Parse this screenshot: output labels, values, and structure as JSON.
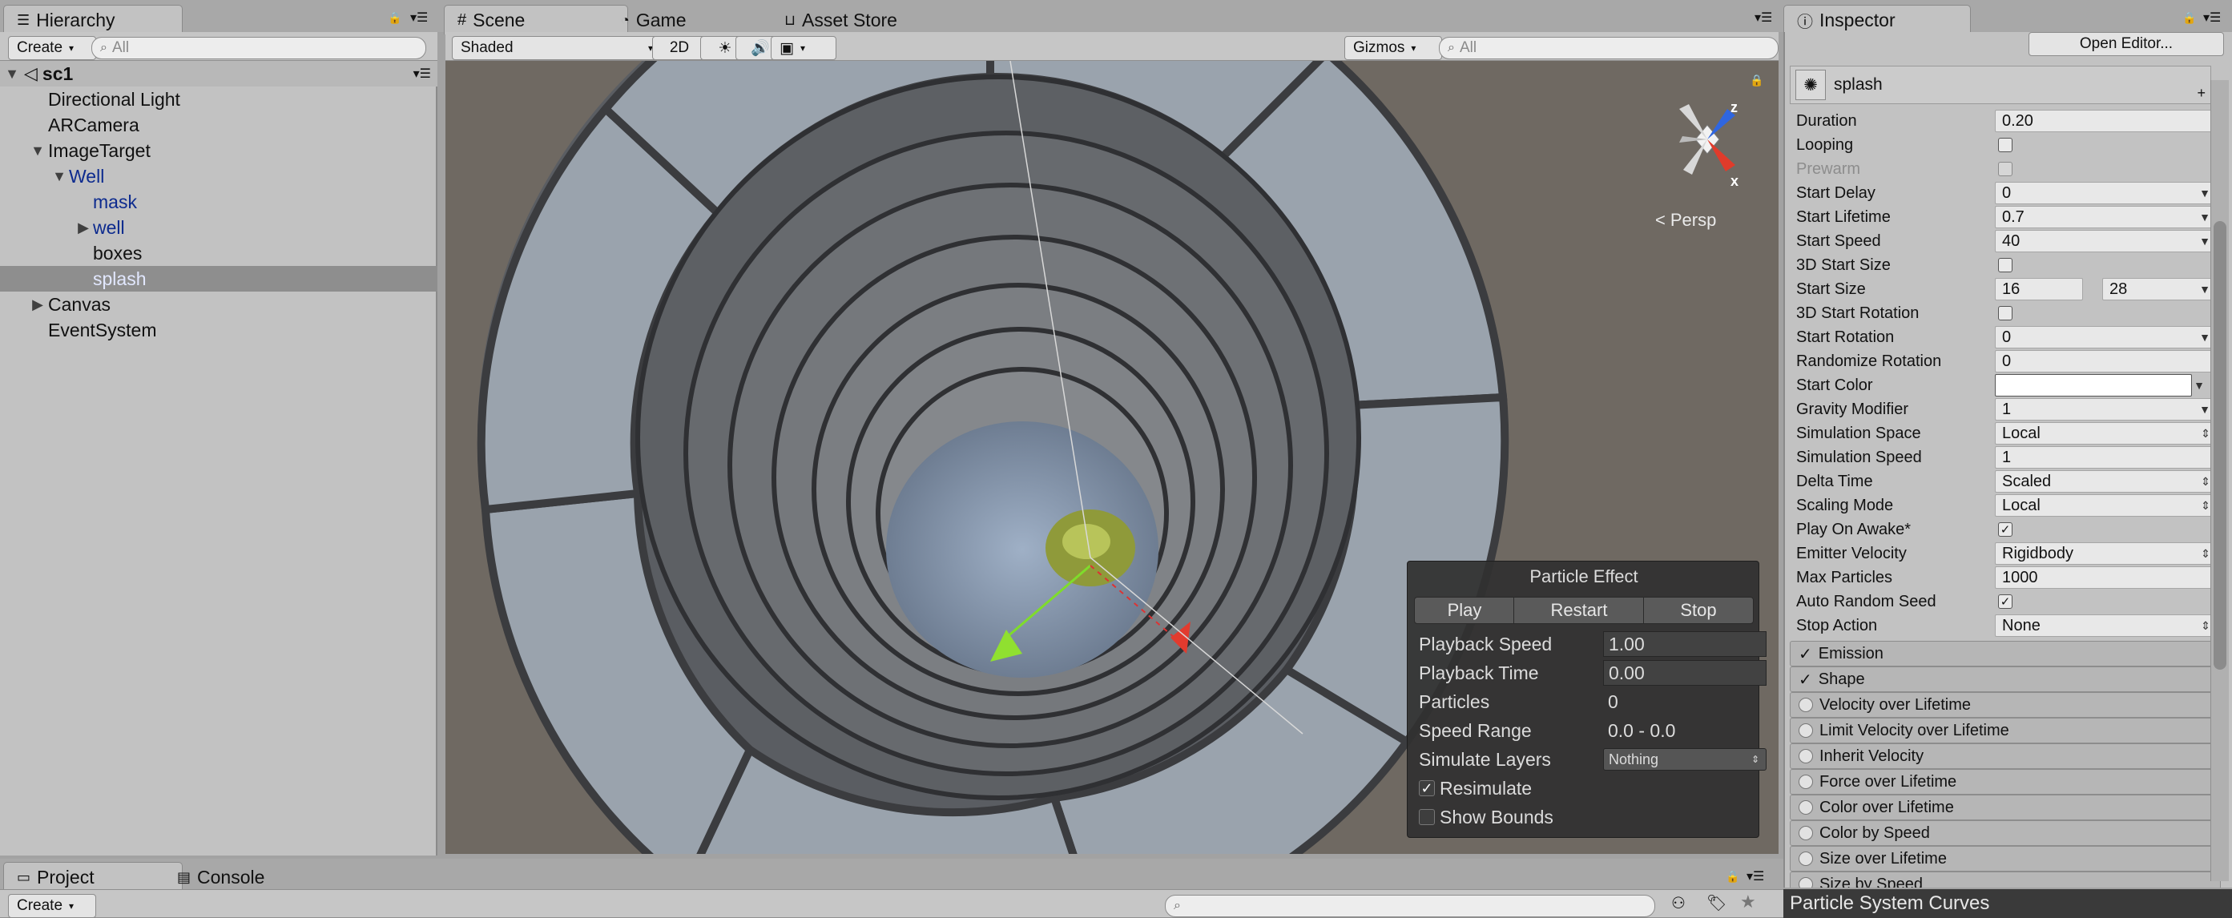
{
  "hierarchy": {
    "tab": "Hierarchy",
    "create": "Create",
    "search_placeholder": "All",
    "scene": "sc1",
    "items": [
      {
        "label": "Directional Light"
      },
      {
        "label": "ARCamera"
      },
      {
        "label": "ImageTarget"
      },
      {
        "label": "Well"
      },
      {
        "label": "mask"
      },
      {
        "label": "well"
      },
      {
        "label": "boxes"
      },
      {
        "label": "splash"
      },
      {
        "label": "Canvas"
      },
      {
        "label": "EventSystem"
      }
    ]
  },
  "scene_tabs": {
    "scene": "Scene",
    "game": "Game",
    "asset_store": "Asset Store"
  },
  "scene_toolbar": {
    "shading": "Shaded",
    "mode_2d": "2D",
    "gizmos": "Gizmos",
    "search_placeholder": "All"
  },
  "gizmo": {
    "persp": "Persp",
    "axis_z": "z",
    "axis_x": "x"
  },
  "particle_effect": {
    "title": "Particle Effect",
    "play": "Play",
    "restart": "Restart",
    "stop": "Stop",
    "playback_speed_label": "Playback Speed",
    "playback_speed": "1.00",
    "playback_time_label": "Playback Time",
    "playback_time": "0.00",
    "particles_label": "Particles",
    "particles": "0",
    "speed_range_label": "Speed Range",
    "speed_range": "0.0 - 0.0",
    "simulate_layers_label": "Simulate Layers",
    "simulate_layers": "Nothing",
    "resimulate_label": "Resimulate",
    "resimulate": true,
    "show_bounds_label": "Show Bounds",
    "show_bounds": false
  },
  "inspector": {
    "tab": "Inspector",
    "open_editor": "Open Editor...",
    "component": "splash",
    "colors": {
      "start_color": "#ffffff"
    },
    "fields": {
      "duration": {
        "label": "Duration",
        "value": "0.20"
      },
      "looping": {
        "label": "Looping",
        "checked": false
      },
      "prewarm": {
        "label": "Prewarm",
        "checked": false
      },
      "start_delay": {
        "label": "Start Delay",
        "value": "0"
      },
      "start_lifetime": {
        "label": "Start Lifetime",
        "value": "0.7"
      },
      "start_speed": {
        "label": "Start Speed",
        "value": "40"
      },
      "start_size_3d": {
        "label": "3D Start Size",
        "checked": false
      },
      "start_size": {
        "label": "Start Size",
        "min": "16",
        "max": "28"
      },
      "start_rotation_3d": {
        "label": "3D Start Rotation",
        "checked": false
      },
      "start_rotation": {
        "label": "Start Rotation",
        "value": "0"
      },
      "randomize_rotation": {
        "label": "Randomize Rotation",
        "value": "0"
      },
      "start_color": {
        "label": "Start Color"
      },
      "gravity_modifier": {
        "label": "Gravity Modifier",
        "value": "1"
      },
      "simulation_space": {
        "label": "Simulation Space",
        "value": "Local"
      },
      "simulation_speed": {
        "label": "Simulation Speed",
        "value": "1"
      },
      "delta_time": {
        "label": "Delta Time",
        "value": "Scaled"
      },
      "scaling_mode": {
        "label": "Scaling Mode",
        "value": "Local"
      },
      "play_on_awake": {
        "label": "Play On Awake*",
        "checked": true
      },
      "emitter_velocity": {
        "label": "Emitter Velocity",
        "value": "Rigidbody"
      },
      "max_particles": {
        "label": "Max Particles",
        "value": "1000"
      },
      "auto_random_seed": {
        "label": "Auto Random Seed",
        "checked": true
      },
      "stop_action": {
        "label": "Stop Action",
        "value": "None"
      }
    },
    "modules": [
      {
        "label": "Emission",
        "enabled": true
      },
      {
        "label": "Shape",
        "enabled": true
      },
      {
        "label": "Velocity over Lifetime",
        "enabled": false
      },
      {
        "label": "Limit Velocity over Lifetime",
        "enabled": false
      },
      {
        "label": "Inherit Velocity",
        "enabled": false
      },
      {
        "label": "Force over Lifetime",
        "enabled": false
      },
      {
        "label": "Color over Lifetime",
        "enabled": false
      },
      {
        "label": "Color by Speed",
        "enabled": false
      },
      {
        "label": "Size over Lifetime",
        "enabled": false
      },
      {
        "label": "Size by Speed",
        "enabled": false
      }
    ]
  },
  "bottom": {
    "project_tab": "Project",
    "console_tab": "Console",
    "create": "Create",
    "curves": "Particle System Curves"
  }
}
